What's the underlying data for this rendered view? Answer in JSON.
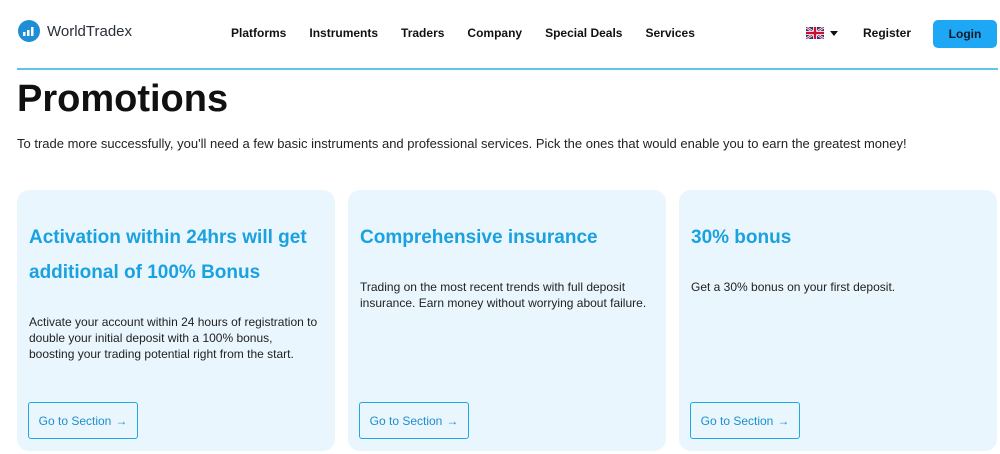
{
  "header": {
    "brand": "WorldTradex",
    "nav": [
      "Platforms",
      "Instruments",
      "Traders",
      "Company",
      "Special Deals",
      "Services"
    ],
    "language_icon": "uk-flag-icon",
    "register": "Register",
    "login": "Login"
  },
  "main": {
    "title": "Promotions",
    "intro": "To trade more successfully, you'll need a few basic instruments and professional services. Pick the ones that would enable you to earn the greatest money!",
    "cards": [
      {
        "title": "Activation within 24hrs will get additional of 100% Bonus",
        "text": "Activate your account within 24 hours of registration to double your initial deposit with a 100% bonus, boosting your trading potential right from the start.",
        "button": "Go to Section"
      },
      {
        "title": "Comprehensive insurance",
        "text": "Trading on the most recent trends with full deposit insurance. Earn money without worrying about failure.",
        "button": "Go to Section"
      },
      {
        "title": "30% bonus",
        "text": "Get a 30% bonus on your first deposit.",
        "button": "Go to Section"
      }
    ]
  },
  "colors": {
    "accent": "#19a1e0",
    "login_bg": "#1ea7f4",
    "card_bg": "#eaf6fd",
    "divider": "#5fc6e8"
  }
}
